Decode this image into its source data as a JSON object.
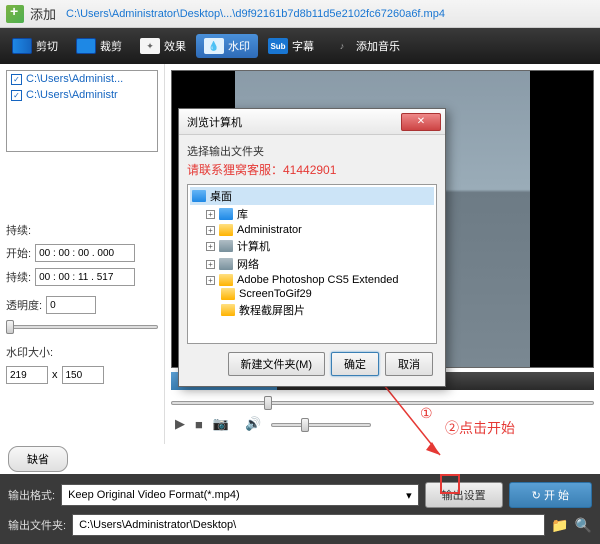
{
  "titlebar": {
    "title": "添加",
    "path": "C:\\Users\\Administrator\\Desktop\\...\\d9f92161b7d8b11d5e2102fc67260a6f.mp4"
  },
  "toolbar": {
    "cut": "剪切",
    "crop": "裁剪",
    "fx": "效果",
    "watermark": "水印",
    "subtitle": "字幕",
    "music": "添加音乐",
    "sub_badge": "Sub"
  },
  "filelist": {
    "items": [
      "C:\\Users\\Administ...",
      "C:\\Users\\Administr"
    ]
  },
  "controls": {
    "duration_label": "持续:",
    "start_label": "开始:",
    "start_value": "00 : 00 : 00 . 000",
    "continue_label": "持续:",
    "continue_value": "00 : 00 : 11 . 517",
    "opacity_label": "透明度:",
    "opacity_value": "0",
    "wmsize_label": "水印大小:",
    "wm_w": "219",
    "wm_sep": "x",
    "wm_h": "150",
    "default_btn": "缺省"
  },
  "dialog": {
    "title": "浏览计算机",
    "prompt": "选择输出文件夹",
    "contact": "请联系狸窝客服：41442901",
    "tree": [
      "桌面",
      "库",
      "Administrator",
      "计算机",
      "网络",
      "Adobe Photoshop CS5 Extended",
      "ScreenToGif29",
      "教程截屏图片"
    ],
    "new_folder": "新建文件夹(M)",
    "ok": "确定",
    "cancel": "取消"
  },
  "footer": {
    "format_label": "输出格式:",
    "format_value": "Keep Original Video Format(*.mp4)",
    "settings_btn": "输出设置",
    "start_btn": "开 始",
    "start_icon": "↻",
    "folder_label": "输出文件夹:",
    "folder_value": "C:\\Users\\Administrator\\Desktop\\"
  },
  "annotations": {
    "step1": "①",
    "step2": "②点击开始"
  }
}
